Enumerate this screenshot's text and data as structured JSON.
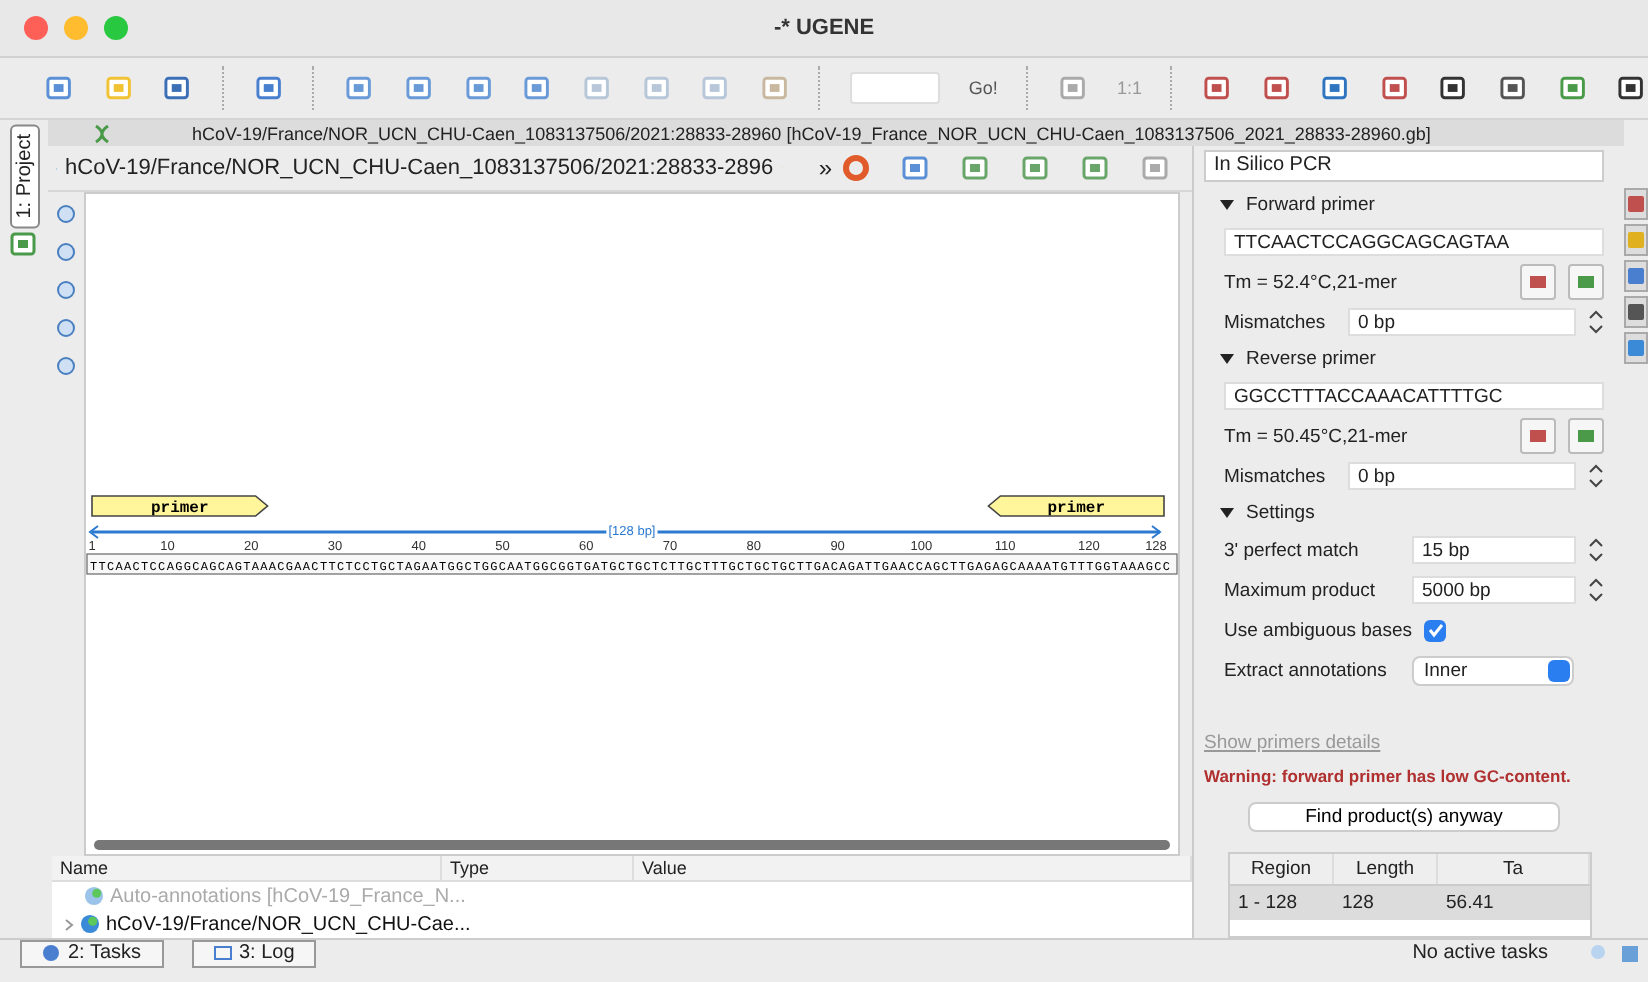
{
  "window": {
    "title": "-* UGENE"
  },
  "toolbar": {
    "go_label": "Go!",
    "zoom_label": "1:1"
  },
  "left_tabs": [
    {
      "label": "1: Project",
      "selected": true
    }
  ],
  "document": {
    "title": "hCoV-19/France/NOR_UCN_CHU-Caen_1083137506/2021:28833-28960 [hCoV-19_France_NOR_UCN_CHU-Caen_1083137506_2021_28833-28960.gb]"
  },
  "sequence_view": {
    "name": "hCoV-19/France/NOR_UCN_CHU-Caen_1083137506/2021:28833-2896",
    "overflow": "»",
    "span_label": "[128 bp]",
    "annotations": [
      {
        "label": "primer",
        "kind": "forward"
      },
      {
        "label": "primer",
        "kind": "reverse"
      }
    ],
    "ticks": [
      "1",
      "10",
      "20",
      "30",
      "40",
      "50",
      "60",
      "70",
      "80",
      "90",
      "100",
      "110",
      "120",
      "128"
    ],
    "sequence": "TTCAACTCCAGGCAGCAGTAAACGAACTTCTCCTGCTAGAATGGCTGGCAATGGCGGTGATGCTGCTCTTGCTTTGCTGCTGCTTGACAGATTGAACCAGCTTGAGAGCAAAATGTTTGGTAAAGCC"
  },
  "tree": {
    "columns": [
      "Name",
      "Type",
      "Value"
    ],
    "items": [
      {
        "label": "Auto-annotations [hCoV-19_France_N...",
        "kind": "auto"
      },
      {
        "label": "hCoV-19/France/NOR_UCN_CHU-Cae...",
        "kind": "object"
      }
    ]
  },
  "panel": {
    "title": "In Silico PCR",
    "forward": {
      "heading": "Forward primer",
      "expanded": true,
      "sequence": "TTCAACTCCAGGCAGCAGTAA",
      "tm": "Tm = 52.4°C,21-mer",
      "mismatches_label": "Mismatches",
      "mismatches": "0 bp"
    },
    "reverse": {
      "heading": "Reverse primer",
      "expanded": true,
      "sequence": "GGCCTTTACCAAACATTTTGC",
      "tm": "Tm = 50.45°C,21-mer",
      "mismatches_label": "Mismatches",
      "mismatches": "0 bp"
    },
    "settings": {
      "heading": "Settings",
      "expanded": true,
      "perfect_match_label": "3' perfect match",
      "perfect_match": "15 bp",
      "max_product_label": "Maximum product",
      "max_product": "5000 bp",
      "ambiguous_label": "Use ambiguous bases",
      "ambiguous_checked": true,
      "extract_label": "Extract annotations",
      "extract_value": "Inner"
    },
    "details_link": "Show primers details",
    "warning": "Warning: forward primer has low GC-content.",
    "find_button": "Find product(s) anyway",
    "results": {
      "columns": [
        "Region",
        "Length",
        "Ta"
      ],
      "rows": [
        {
          "cells": [
            "1 - 128",
            "128",
            "56.41"
          ],
          "selected": true
        }
      ]
    }
  },
  "bottom_tabs": [
    {
      "label": "2: Tasks"
    },
    {
      "label": "3: Log"
    }
  ],
  "status": "No active tasks"
}
